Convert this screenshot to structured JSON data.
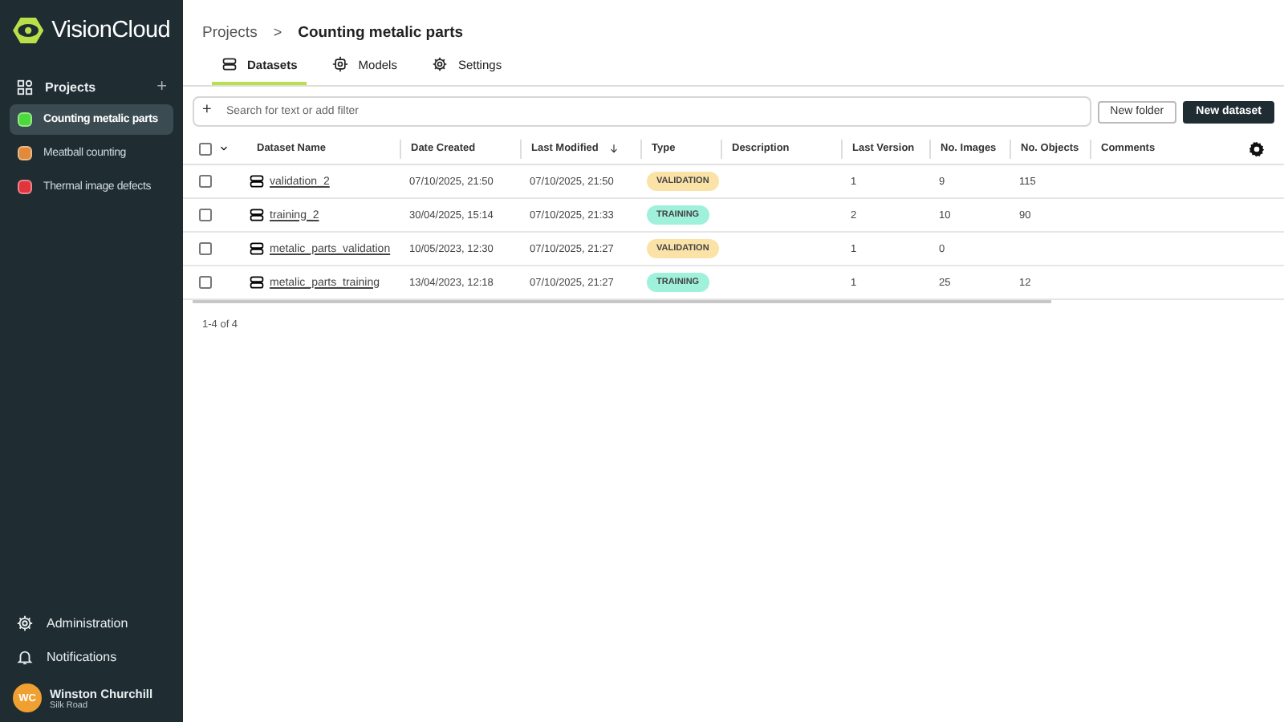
{
  "brand": {
    "name": "VisionCloud"
  },
  "sidebar": {
    "section": "Projects",
    "add": "+",
    "projects": [
      {
        "name": "Counting metalic parts",
        "color": "#4cd93a",
        "selected": true
      },
      {
        "name": "Meatball counting",
        "color": "#e08a3a",
        "selected": false
      },
      {
        "name": "Thermal image defects",
        "color": "#e0353f",
        "selected": false
      }
    ],
    "bottom": [
      {
        "label": "Administration",
        "kind": "gear"
      },
      {
        "label": "Notifications",
        "kind": "bell"
      }
    ],
    "user": {
      "initials": "WC",
      "name": "Winston Churchill",
      "org": "Silk Road"
    }
  },
  "breadcrumb": {
    "parent": "Projects",
    "separator": ">",
    "current": "Counting metalic parts"
  },
  "tabs": [
    {
      "label": "Datasets",
      "kind": "datasets",
      "selected": true
    },
    {
      "label": "Models",
      "kind": "models",
      "selected": false
    },
    {
      "label": "Settings",
      "kind": "settings",
      "selected": false
    }
  ],
  "search": {
    "add": "+",
    "placeholder": "Search for text or add filter"
  },
  "buttons": [
    {
      "label": "New folder",
      "kind": "secondary"
    },
    {
      "label": "New dataset",
      "kind": "primary"
    }
  ],
  "table": {
    "select_all": false,
    "columns": [
      "Dataset Name",
      "Date Created",
      "Last Modified",
      "Type",
      "Description",
      "Last Version",
      "No. Images",
      "No. Objects",
      "Comments"
    ],
    "rows": [
      {
        "checked": false,
        "name": "validation_2",
        "created": "07/10/2025, 21:50",
        "modified": "07/10/2025, 21:50",
        "type": "VALIDATION",
        "kind": "validation",
        "version": "1",
        "images": "9",
        "objects": "115"
      },
      {
        "checked": false,
        "name": "training_2",
        "created": "30/04/2025, 15:14",
        "modified": "07/10/2025, 21:33",
        "type": "TRAINING",
        "kind": "training",
        "version": "2",
        "images": "10",
        "objects": "90"
      },
      {
        "checked": false,
        "name": "metalic_parts_validation",
        "created": "10/05/2023, 12:30",
        "modified": "07/10/2025, 21:27",
        "type": "VALIDATION",
        "kind": "validation",
        "version": "1",
        "images": "0"
      },
      {
        "checked": false,
        "name": "metalic_parts_training",
        "created": "13/04/2023, 12:18",
        "modified": "07/10/2025, 21:27",
        "type": "TRAINING",
        "kind": "training",
        "version": "1",
        "images": "25",
        "objects": "12"
      }
    ],
    "footer": "1-4 of 4"
  }
}
